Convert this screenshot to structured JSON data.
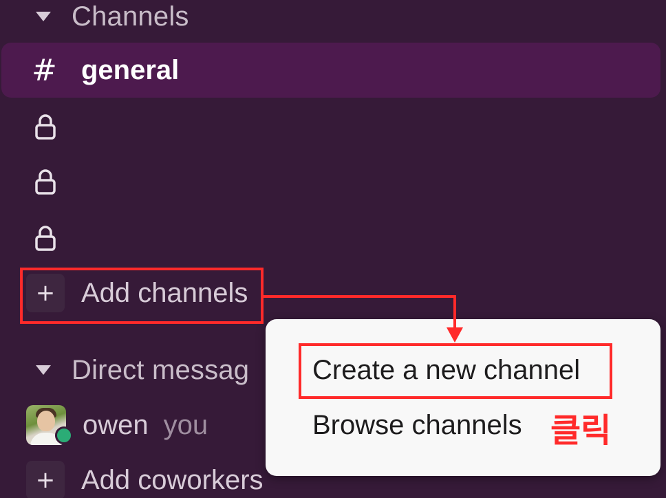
{
  "sidebar": {
    "channels_section": {
      "title": "Channels"
    },
    "channels": [
      {
        "prefix": "#",
        "name": "general",
        "active": true
      },
      {
        "prefix": "lock",
        "name": ""
      },
      {
        "prefix": "lock",
        "name": ""
      },
      {
        "prefix": "lock",
        "name": ""
      }
    ],
    "add_channels": {
      "icon": "+",
      "label": "Add channels"
    },
    "dm_section": {
      "title": "Direct messag"
    },
    "dms": [
      {
        "name": "owen",
        "note": "you",
        "status": "active"
      }
    ],
    "add_coworkers": {
      "icon": "+",
      "label": "Add coworkers"
    }
  },
  "popup_menu": {
    "items": [
      {
        "label": "Create a new channel"
      },
      {
        "label": "Browse channels"
      }
    ]
  },
  "annotation": {
    "text": "클릭",
    "color": "#ff2a2a"
  },
  "colors": {
    "sidebar_bg": "#361a38",
    "active_channel_bg": "#4d1a4e",
    "presence_online": "#2bac76",
    "menu_bg": "#f8f8f8"
  }
}
